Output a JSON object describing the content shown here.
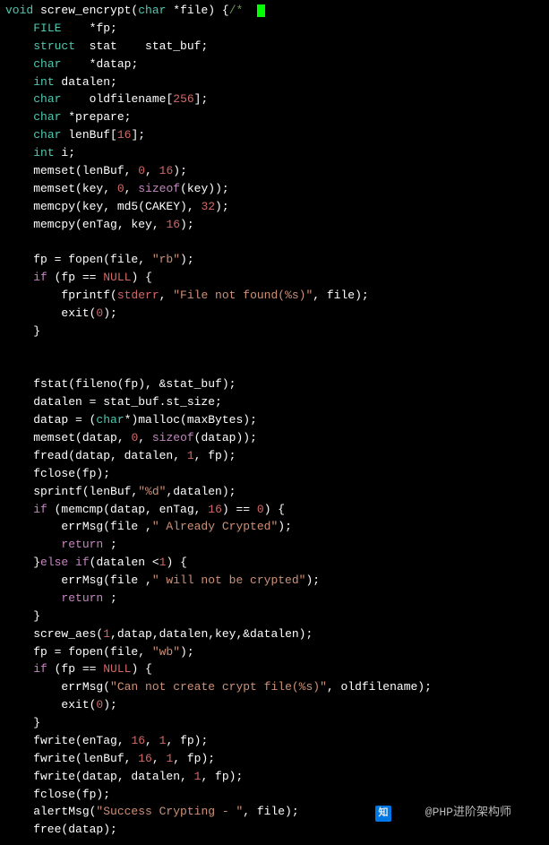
{
  "code": {
    "lines": [
      {
        "tokens": [
          {
            "t": "void",
            "c": "kw-void"
          },
          {
            "t": " screw_encrypt("
          },
          {
            "t": "char",
            "c": "kw-type"
          },
          {
            "t": " *file) {"
          },
          {
            "t": "/*",
            "c": "comment"
          },
          {
            "t": "  ",
            "c": "dim"
          },
          {
            "t": "",
            "cursor": true
          }
        ]
      },
      {
        "tokens": [
          {
            "t": "    FILE    *fp;"
          }
        ],
        "leading_kw": "FILE",
        "after": "    *fp;"
      },
      {
        "tokens": [
          {
            "t": "    "
          },
          {
            "t": "struct",
            "c": "kw-type"
          },
          {
            "t": "  stat    stat_buf;"
          }
        ]
      },
      {
        "tokens": [
          {
            "t": "    "
          },
          {
            "t": "char",
            "c": "kw-type"
          },
          {
            "t": "    *datap;"
          }
        ]
      },
      {
        "tokens": [
          {
            "t": "    "
          },
          {
            "t": "int",
            "c": "kw-type"
          },
          {
            "t": " datalen;"
          }
        ]
      },
      {
        "tokens": [
          {
            "t": "    "
          },
          {
            "t": "char",
            "c": "kw-type"
          },
          {
            "t": "    oldfilename["
          },
          {
            "t": "256",
            "c": "num"
          },
          {
            "t": "];"
          }
        ]
      },
      {
        "tokens": [
          {
            "t": "    "
          },
          {
            "t": "char",
            "c": "kw-type"
          },
          {
            "t": " *prepare;"
          }
        ]
      },
      {
        "tokens": [
          {
            "t": "    "
          },
          {
            "t": "char",
            "c": "kw-type"
          },
          {
            "t": " lenBuf["
          },
          {
            "t": "16",
            "c": "num"
          },
          {
            "t": "];"
          }
        ]
      },
      {
        "tokens": [
          {
            "t": "    "
          },
          {
            "t": "int",
            "c": "kw-type"
          },
          {
            "t": " i;"
          }
        ]
      },
      {
        "tokens": [
          {
            "t": "    memset(lenBuf, "
          },
          {
            "t": "0",
            "c": "num"
          },
          {
            "t": ", "
          },
          {
            "t": "16",
            "c": "num"
          },
          {
            "t": ");"
          }
        ]
      },
      {
        "tokens": [
          {
            "t": "    memset(key, "
          },
          {
            "t": "0",
            "c": "num"
          },
          {
            "t": ", "
          },
          {
            "t": "sizeof",
            "c": "sizeof"
          },
          {
            "t": "(key));"
          }
        ]
      },
      {
        "tokens": [
          {
            "t": "    memcpy(key, md5(CAKEY), "
          },
          {
            "t": "32",
            "c": "num"
          },
          {
            "t": ");"
          }
        ]
      },
      {
        "tokens": [
          {
            "t": "    memcpy(enTag, key, "
          },
          {
            "t": "16",
            "c": "num"
          },
          {
            "t": ");"
          }
        ]
      },
      {
        "tokens": [
          {
            "t": ""
          }
        ]
      },
      {
        "tokens": [
          {
            "t": "    fp = fopen(file, "
          },
          {
            "t": "\"rb\"",
            "c": "str"
          },
          {
            "t": ");"
          }
        ]
      },
      {
        "tokens": [
          {
            "t": "    "
          },
          {
            "t": "if",
            "c": "kw-if"
          },
          {
            "t": " (fp == "
          },
          {
            "t": "NULL",
            "c": "null"
          },
          {
            "t": ") {"
          }
        ]
      },
      {
        "tokens": [
          {
            "t": "        fprintf("
          },
          {
            "t": "stderr",
            "c": "stderr"
          },
          {
            "t": ", "
          },
          {
            "t": "\"File not found(%s)\"",
            "c": "str"
          },
          {
            "t": ", file);"
          }
        ]
      },
      {
        "tokens": [
          {
            "t": "        exit("
          },
          {
            "t": "0",
            "c": "num"
          },
          {
            "t": ");"
          }
        ]
      },
      {
        "tokens": [
          {
            "t": "    }"
          }
        ]
      },
      {
        "tokens": [
          {
            "t": ""
          }
        ]
      },
      {
        "tokens": [
          {
            "t": ""
          }
        ]
      },
      {
        "tokens": [
          {
            "t": "    fstat(fileno(fp), &stat_buf);"
          }
        ]
      },
      {
        "tokens": [
          {
            "t": "    datalen = stat_buf.st_size;"
          }
        ]
      },
      {
        "tokens": [
          {
            "t": "    datap = ("
          },
          {
            "t": "char",
            "c": "kw-type"
          },
          {
            "t": "*)malloc(maxBytes);"
          }
        ]
      },
      {
        "tokens": [
          {
            "t": "    memset(datap, "
          },
          {
            "t": "0",
            "c": "num"
          },
          {
            "t": ", "
          },
          {
            "t": "sizeof",
            "c": "sizeof"
          },
          {
            "t": "(datap));"
          }
        ]
      },
      {
        "tokens": [
          {
            "t": "    fread(datap, datalen, "
          },
          {
            "t": "1",
            "c": "num"
          },
          {
            "t": ", fp);"
          }
        ]
      },
      {
        "tokens": [
          {
            "t": "    fclose(fp);"
          }
        ]
      },
      {
        "tokens": [
          {
            "t": "    sprintf(lenBuf,"
          },
          {
            "t": "\"%d\"",
            "c": "str"
          },
          {
            "t": ",datalen);"
          }
        ]
      },
      {
        "tokens": [
          {
            "t": "    "
          },
          {
            "t": "if",
            "c": "kw-if"
          },
          {
            "t": " (memcmp(datap, enTag, "
          },
          {
            "t": "16",
            "c": "num"
          },
          {
            "t": ") == "
          },
          {
            "t": "0",
            "c": "num"
          },
          {
            "t": ") {"
          }
        ]
      },
      {
        "tokens": [
          {
            "t": "        errMsg(file ,"
          },
          {
            "t": "\" Already Crypted\"",
            "c": "str"
          },
          {
            "t": ");"
          }
        ]
      },
      {
        "tokens": [
          {
            "t": "        "
          },
          {
            "t": "return",
            "c": "kw-return"
          },
          {
            "t": " ;"
          }
        ]
      },
      {
        "tokens": [
          {
            "t": "    }"
          },
          {
            "t": "else",
            "c": "kw-else"
          },
          {
            "t": " "
          },
          {
            "t": "if",
            "c": "kw-if"
          },
          {
            "t": "(datalen <"
          },
          {
            "t": "1",
            "c": "num"
          },
          {
            "t": ") {"
          }
        ]
      },
      {
        "tokens": [
          {
            "t": "        errMsg(file ,"
          },
          {
            "t": "\" will not be crypted\"",
            "c": "str"
          },
          {
            "t": ");"
          }
        ]
      },
      {
        "tokens": [
          {
            "t": "        "
          },
          {
            "t": "return",
            "c": "kw-return"
          },
          {
            "t": " ;"
          }
        ]
      },
      {
        "tokens": [
          {
            "t": "    }"
          }
        ]
      },
      {
        "tokens": [
          {
            "t": "    screw_aes("
          },
          {
            "t": "1",
            "c": "num"
          },
          {
            "t": ",datap,datalen,key,&datalen);"
          }
        ]
      },
      {
        "tokens": [
          {
            "t": "    fp = fopen(file, "
          },
          {
            "t": "\"wb\"",
            "c": "str"
          },
          {
            "t": ");"
          }
        ]
      },
      {
        "tokens": [
          {
            "t": "    "
          },
          {
            "t": "if",
            "c": "kw-if"
          },
          {
            "t": " (fp == "
          },
          {
            "t": "NULL",
            "c": "null"
          },
          {
            "t": ") {"
          }
        ]
      },
      {
        "tokens": [
          {
            "t": "        errMsg("
          },
          {
            "t": "\"Can not create crypt file(%s)\"",
            "c": "str"
          },
          {
            "t": ", oldfilename);"
          }
        ]
      },
      {
        "tokens": [
          {
            "t": "        exit("
          },
          {
            "t": "0",
            "c": "num"
          },
          {
            "t": ");"
          }
        ]
      },
      {
        "tokens": [
          {
            "t": "    }"
          }
        ]
      },
      {
        "tokens": [
          {
            "t": "    fwrite(enTag, "
          },
          {
            "t": "16",
            "c": "num"
          },
          {
            "t": ", "
          },
          {
            "t": "1",
            "c": "num"
          },
          {
            "t": ", fp);"
          }
        ]
      },
      {
        "tokens": [
          {
            "t": "    fwrite(lenBuf, "
          },
          {
            "t": "16",
            "c": "num"
          },
          {
            "t": ", "
          },
          {
            "t": "1",
            "c": "num"
          },
          {
            "t": ", fp);"
          }
        ]
      },
      {
        "tokens": [
          {
            "t": "    fwrite(datap, datalen, "
          },
          {
            "t": "1",
            "c": "num"
          },
          {
            "t": ", fp);"
          }
        ]
      },
      {
        "tokens": [
          {
            "t": "    fclose(fp);"
          }
        ]
      },
      {
        "tokens": [
          {
            "t": "    alertMsg("
          },
          {
            "t": "\"Success Crypting - \"",
            "c": "str"
          },
          {
            "t": ", file);"
          }
        ]
      },
      {
        "tokens": [
          {
            "t": "    free(datap);"
          }
        ]
      }
    ],
    "line1_file_color": "kw-type"
  },
  "watermark": {
    "logo": "知",
    "text": "@PHP进阶架构师"
  }
}
